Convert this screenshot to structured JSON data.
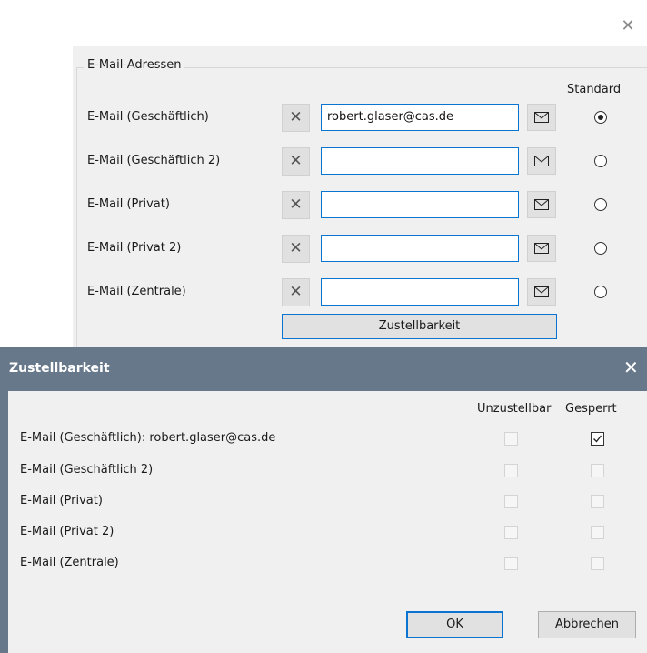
{
  "window": {
    "close_icon": "close-icon"
  },
  "group": {
    "legend": "E-Mail-Adressen",
    "standard_header": "Standard",
    "rows": [
      {
        "label": "E-Mail (Geschäftlich)",
        "value": "robert.glaser@cas.de",
        "is_standard": true
      },
      {
        "label": "E-Mail (Geschäftlich 2)",
        "value": "",
        "is_standard": false
      },
      {
        "label": "E-Mail (Privat)",
        "value": "",
        "is_standard": false
      },
      {
        "label": "E-Mail (Privat 2)",
        "value": "",
        "is_standard": false
      },
      {
        "label": "E-Mail (Zentrale)",
        "value": "",
        "is_standard": false
      }
    ],
    "zustellbarkeit_button": "Zustellbarkeit"
  },
  "dialog": {
    "title": "Zustellbarkeit",
    "col_unzustellbar": "Unzustellbar",
    "col_gesperrt": "Gesperrt",
    "rows": [
      {
        "label": "E-Mail (Geschäftlich): robert.glaser@cas.de",
        "unzustellbar": false,
        "gesperrt": true
      },
      {
        "label": "E-Mail (Geschäftlich 2)",
        "unzustellbar": false,
        "gesperrt": false
      },
      {
        "label": "E-Mail (Privat)",
        "unzustellbar": false,
        "gesperrt": false
      },
      {
        "label": "E-Mail (Privat 2)",
        "unzustellbar": false,
        "gesperrt": false
      },
      {
        "label": "E-Mail (Zentrale)",
        "unzustellbar": false,
        "gesperrt": false
      }
    ],
    "ok_label": "OK",
    "cancel_label": "Abbrechen"
  },
  "colors": {
    "accent": "#0a74d0",
    "title_bar": "#66788a"
  }
}
